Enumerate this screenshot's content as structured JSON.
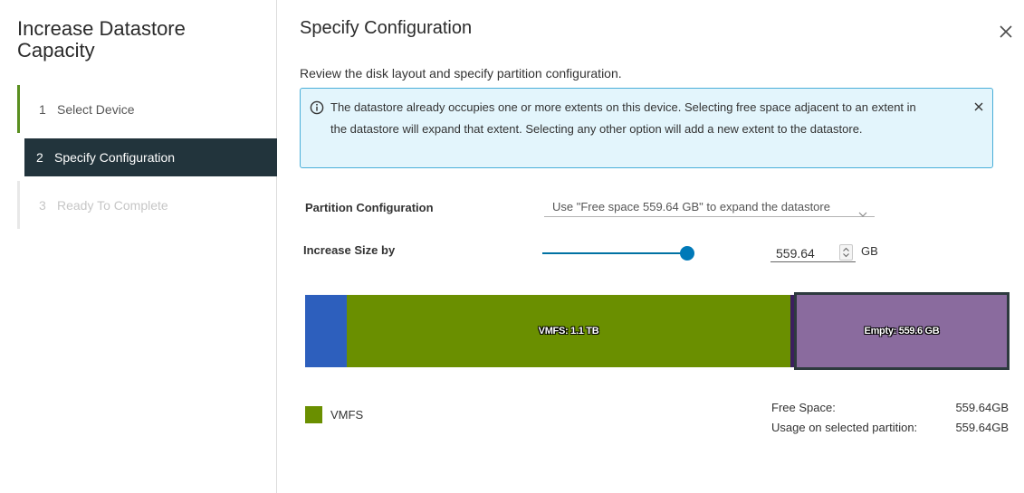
{
  "wizard": {
    "title": "Increase Datastore Capacity",
    "steps": [
      {
        "number": "1",
        "label": "Select Device",
        "state": "done"
      },
      {
        "number": "2",
        "label": "Specify Configuration",
        "state": "active"
      },
      {
        "number": "3",
        "label": "Ready To Complete",
        "state": "disabled"
      }
    ]
  },
  "main": {
    "title": "Specify Configuration",
    "subtitle": "Review the disk layout and specify partition configuration.",
    "alert": {
      "text": "The datastore already occupies one or more extents on this device. Selecting free space adjacent to an extent in the datastore will expand that extent. Selecting any other option will add a new extent to the datastore."
    },
    "partition": {
      "label": "Partition Configuration",
      "selected": "Use \"Free space 559.64 GB\" to expand the datastore"
    },
    "increase": {
      "label": "Increase Size by",
      "value": "559.64",
      "unit": "GB",
      "slider_fraction": 1.0
    },
    "disk": {
      "segments": [
        {
          "label": "",
          "color": "#2d5fbd"
        },
        {
          "label": "VMFS: 1.1 TB",
          "color": "#6a8f00"
        },
        {
          "label": "",
          "color": "#3b1f5e"
        },
        {
          "label": "Empty: 559.6 GB",
          "color": "#8a6b9e"
        }
      ]
    },
    "legend": {
      "label": "VMFS",
      "color": "#6a8f00"
    },
    "stats": {
      "free_space_label": "Free Space:",
      "free_space_value": "559.64GB",
      "usage_label": "Usage on selected partition:",
      "usage_value": "559.64GB"
    }
  },
  "colors": {
    "accent": "#0079b8",
    "sidebar_active": "#22343c",
    "alert_bg": "#e3f5fc",
    "alert_border": "#49afd9"
  },
  "icons": {
    "close": "close-icon",
    "info": "info-icon",
    "caret": "chevron-down-icon",
    "spin": "spinner-icon"
  }
}
